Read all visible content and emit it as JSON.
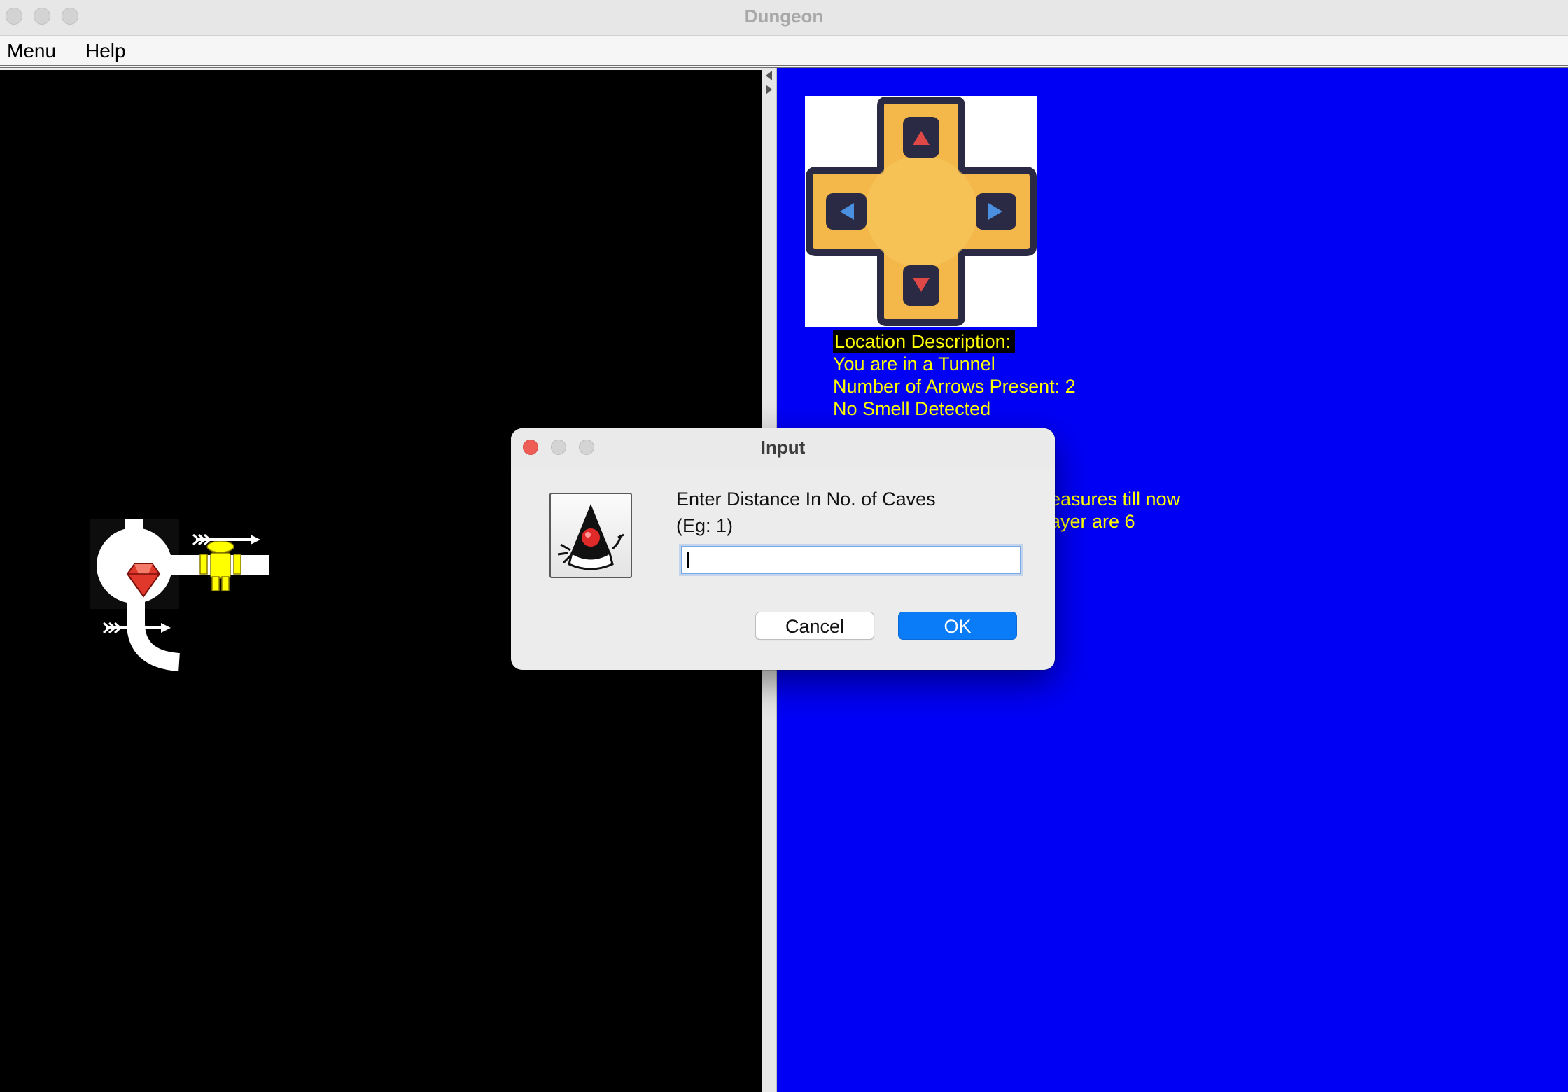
{
  "window": {
    "title": "Dungeon",
    "traffic_lights": [
      "close",
      "minimize",
      "zoom"
    ]
  },
  "menubar": {
    "items": [
      {
        "label": "Menu"
      },
      {
        "label": "Help"
      }
    ]
  },
  "map": {
    "items": [
      "player-icon",
      "ruby-treasure-icon",
      "arrow-icon",
      "arrow-icon"
    ],
    "colors": {
      "background": "#000000",
      "tunnel": "#ffffff",
      "player": "#ffff00",
      "treasure": "#e0392b"
    }
  },
  "info_panel": {
    "background": "#0000f5",
    "text_color": "#ffff00",
    "heading": "Location Description:",
    "lines": [
      "You are in a Tunnel",
      "Number of Arrows Present: 2",
      "No Smell Detected"
    ],
    "partial_lines": [
      "easures till now",
      "ayer are 6"
    ],
    "controller_icon": "dpad-controller-icon"
  },
  "dialog": {
    "title": "Input",
    "icon": "java-duke-icon",
    "prompt_line1": "Enter Distance In No. of Caves",
    "prompt_line2": "(Eg: 1)",
    "input_value": "",
    "cancel_label": "Cancel",
    "ok_label": "OK",
    "accent": "#0a7cf7"
  }
}
